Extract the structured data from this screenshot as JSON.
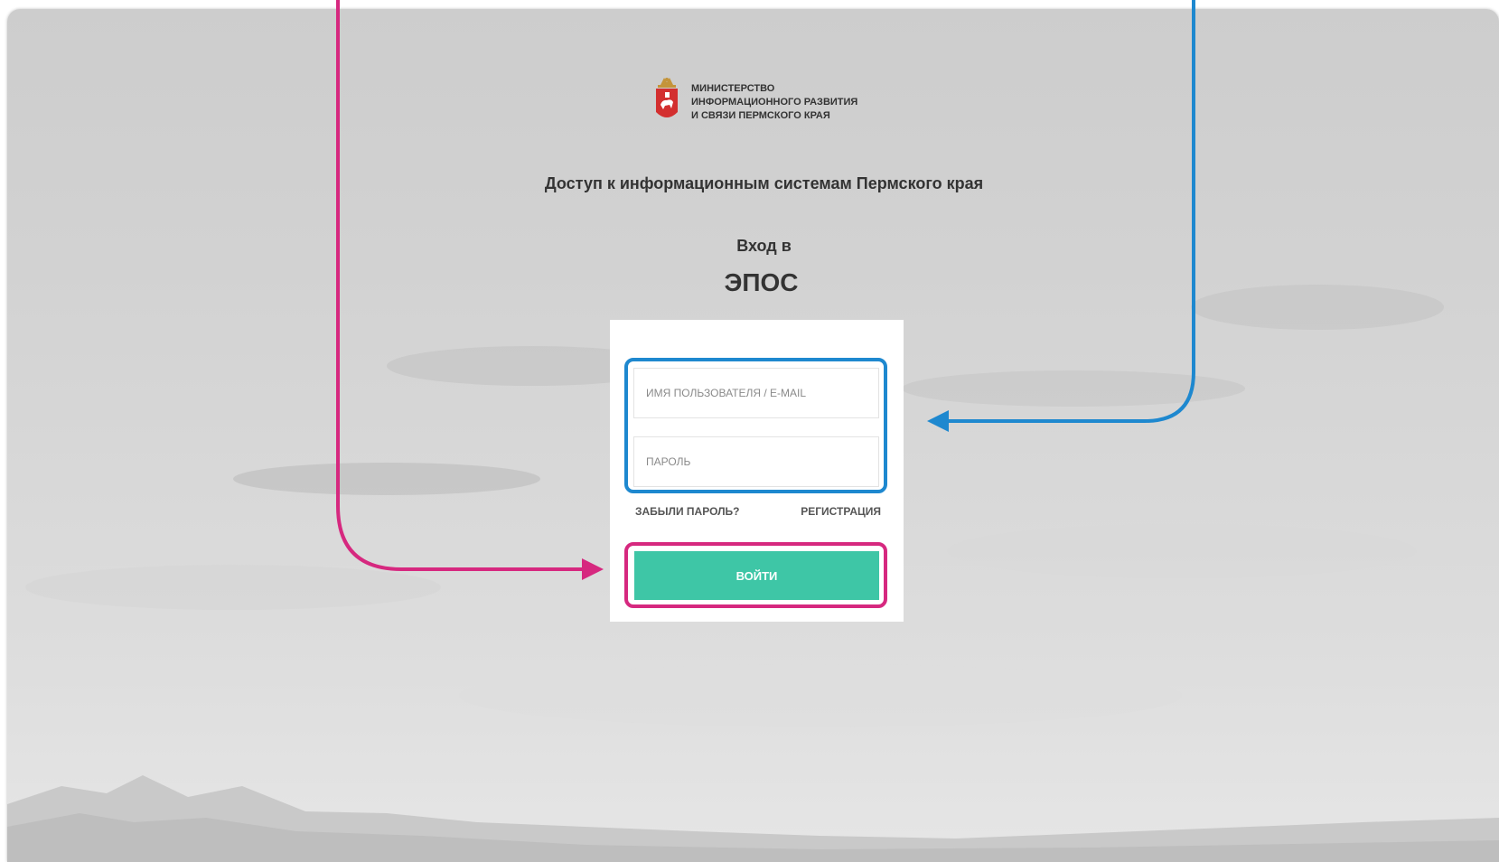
{
  "logo": {
    "line1": "Министерство",
    "line2": "информационного развития",
    "line3": "и связи Пермского края",
    "emblem_icon": "perm-krai-coat-of-arms-icon"
  },
  "page": {
    "subtitle": "Доступ к информационным системам Пермского края",
    "enter_label": "Вход в",
    "system_name": "ЭПОС"
  },
  "form": {
    "username_placeholder": "Имя пользователя / E-mail",
    "password_placeholder": "Пароль",
    "forgot_label": "ЗАБЫЛИ ПАРОЛЬ?",
    "register_label": "РЕГИСТРАЦИЯ",
    "login_button": "ВОЙТИ"
  },
  "colors": {
    "button": "#3ec6a6",
    "highlight_blue": "#1e88cf",
    "highlight_pink": "#d6287f",
    "background": "#d2d2d2"
  }
}
